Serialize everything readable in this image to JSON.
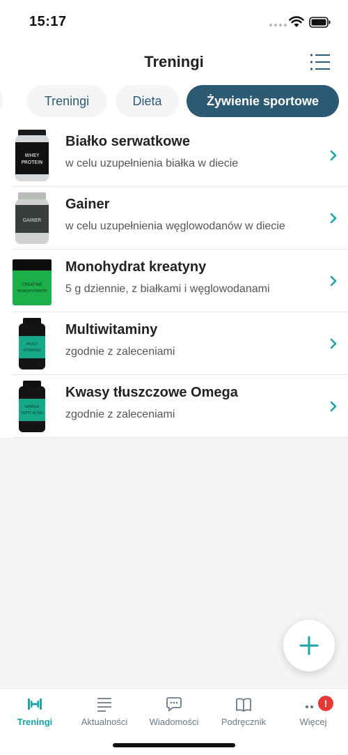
{
  "status": {
    "time": "15:17"
  },
  "header": {
    "title": "Treningi"
  },
  "tabs": [
    {
      "label": ""
    },
    {
      "label": "Treningi"
    },
    {
      "label": "Dieta"
    },
    {
      "label": "Żywienie sportowe"
    }
  ],
  "items": [
    {
      "title": "Białko serwatkowe",
      "subtitle": "w celu uzupełnienia białka w diecie",
      "label_line1": "WHEY",
      "label_line2": "PROTEIN"
    },
    {
      "title": "Gainer",
      "subtitle": "w celu uzupełnienia węglowodanów w diecie",
      "label_line1": "GAINER"
    },
    {
      "title": "Monohydrat kreatyny",
      "subtitle": "5 g dziennie, z białkami i węglowodanami",
      "label_line1": "CREATINE",
      "label_line2": "MONOHYDRATE"
    },
    {
      "title": "Multiwitaminy",
      "subtitle": "zgodnie z zaleceniami",
      "label_line1": "MULTI",
      "label_line2": "VITAMINS"
    },
    {
      "title": "Kwasy tłuszczowe Omega",
      "subtitle": "zgodnie z zaleceniami",
      "label_line1": "OMEGA",
      "label_line2": "FATTY ACIDS"
    }
  ],
  "tabbar": [
    {
      "label": "Treningi",
      "icon": "dumbbell-icon"
    },
    {
      "label": "Aktualności",
      "icon": "news-lines-icon"
    },
    {
      "label": "Wiadomości",
      "icon": "chat-bubble-icon"
    },
    {
      "label": "Podręcznik",
      "icon": "book-icon"
    },
    {
      "label": "Więcej",
      "icon": "more-dots-icon",
      "badge": "!"
    }
  ],
  "colors": {
    "accent": "#1aa3a8",
    "active_tab_bg": "#2c5a72",
    "badge": "#e53935"
  }
}
